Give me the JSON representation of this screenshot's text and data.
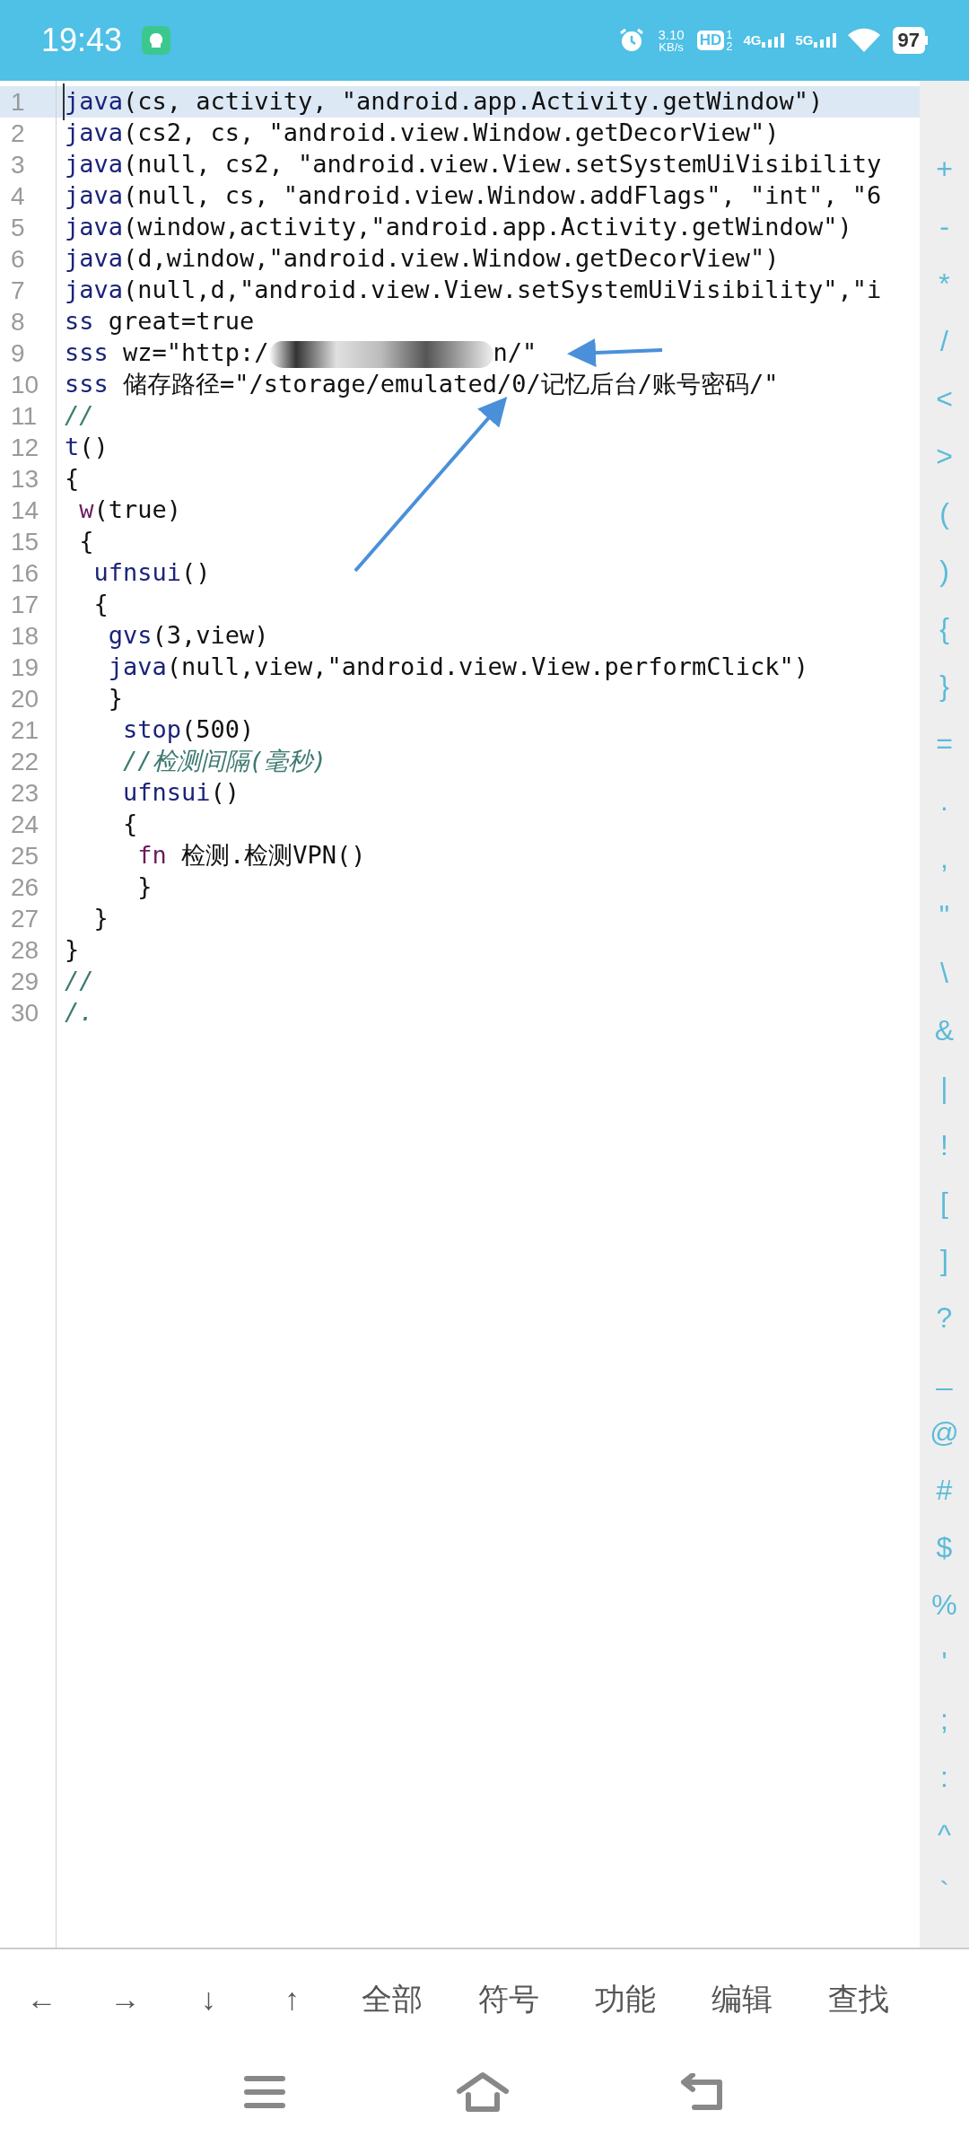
{
  "status_bar": {
    "time": "19:43",
    "network_speed": [
      "3.10",
      "KB/s"
    ],
    "hd": {
      "label": "HD",
      "sup": "1",
      "sub": "2"
    },
    "signals": [
      {
        "label": "4G"
      },
      {
        "label": "5G"
      }
    ],
    "battery": "97"
  },
  "editor": {
    "lines": [
      {
        "number": "1",
        "current": true,
        "tokens": [
          {
            "kind": "keyword",
            "text": "java"
          },
          {
            "kind": "plain",
            "text": "(cs, activity, \"android.app.Activity.getWindow\")"
          }
        ]
      },
      {
        "number": "2",
        "current": false,
        "tokens": [
          {
            "kind": "keyword",
            "text": "java"
          },
          {
            "kind": "plain",
            "text": "(cs2, cs, \"android.view.Window.getDecorView\")"
          }
        ]
      },
      {
        "number": "3",
        "current": false,
        "tokens": [
          {
            "kind": "keyword",
            "text": "java"
          },
          {
            "kind": "plain",
            "text": "(null, cs2, \"android.view.View.setSystemUiVisibility"
          }
        ]
      },
      {
        "number": "4",
        "current": false,
        "tokens": [
          {
            "kind": "keyword",
            "text": "java"
          },
          {
            "kind": "plain",
            "text": "(null, cs, \"android.view.Window.addFlags\", \"int\", \"6"
          }
        ]
      },
      {
        "number": "5",
        "current": false,
        "tokens": [
          {
            "kind": "keyword",
            "text": "java"
          },
          {
            "kind": "plain",
            "text": "(window,activity,\"android.app.Activity.getWindow\")"
          }
        ]
      },
      {
        "number": "6",
        "current": false,
        "tokens": [
          {
            "kind": "keyword",
            "text": "java"
          },
          {
            "kind": "plain",
            "text": "(d,window,\"android.view.Window.getDecorView\")"
          }
        ]
      },
      {
        "number": "7",
        "current": false,
        "tokens": [
          {
            "kind": "keyword",
            "text": "java"
          },
          {
            "kind": "plain",
            "text": "(null,d,\"android.view.View.setSystemUiVisibility\",\"i"
          }
        ]
      },
      {
        "number": "8",
        "current": false,
        "tokens": [
          {
            "kind": "keyword",
            "text": "ss"
          },
          {
            "kind": "plain",
            "text": " great=true"
          }
        ]
      },
      {
        "number": "9",
        "current": false,
        "tokens": [
          {
            "kind": "keyword",
            "text": "sss"
          },
          {
            "kind": "plain",
            "text": " wz=\"http:/"
          },
          {
            "kind": "redacted"
          },
          {
            "kind": "plain",
            "text": "n/\""
          }
        ]
      },
      {
        "number": "10",
        "current": false,
        "tokens": [
          {
            "kind": "keyword",
            "text": "sss"
          },
          {
            "kind": "plain",
            "text": " 储存路径=\"/storage/emulated/0/记忆后台/账号密码/\""
          }
        ]
      },
      {
        "number": "11",
        "current": false,
        "tokens": [
          {
            "kind": "comment",
            "text": "//"
          }
        ]
      },
      {
        "number": "12",
        "current": false,
        "tokens": [
          {
            "kind": "keyword",
            "text": "t"
          },
          {
            "kind": "plain",
            "text": "()"
          }
        ]
      },
      {
        "number": "13",
        "current": false,
        "tokens": [
          {
            "kind": "plain",
            "text": "{"
          }
        ]
      },
      {
        "number": "14",
        "current": false,
        "tokens": [
          {
            "kind": "function",
            "text": " w"
          },
          {
            "kind": "plain",
            "text": "(true)"
          }
        ]
      },
      {
        "number": "15",
        "current": false,
        "tokens": [
          {
            "kind": "plain",
            "text": " {"
          }
        ]
      },
      {
        "number": "16",
        "current": false,
        "tokens": [
          {
            "kind": "keyword",
            "text": "  ufnsui"
          },
          {
            "kind": "plain",
            "text": "()"
          }
        ]
      },
      {
        "number": "17",
        "current": false,
        "tokens": [
          {
            "kind": "plain",
            "text": "  {"
          }
        ]
      },
      {
        "number": "18",
        "current": false,
        "tokens": [
          {
            "kind": "keyword",
            "text": "   gvs"
          },
          {
            "kind": "plain",
            "text": "(3,view)"
          }
        ]
      },
      {
        "number": "19",
        "current": false,
        "tokens": [
          {
            "kind": "keyword",
            "text": "   java"
          },
          {
            "kind": "plain",
            "text": "(null,view,\"android.view.View.performClick\")"
          }
        ]
      },
      {
        "number": "20",
        "current": false,
        "tokens": [
          {
            "kind": "plain",
            "text": "   }"
          }
        ]
      },
      {
        "number": "21",
        "current": false,
        "tokens": [
          {
            "kind": "keyword",
            "text": "    stop"
          },
          {
            "kind": "plain",
            "text": "(500)"
          }
        ]
      },
      {
        "number": "22",
        "current": false,
        "tokens": [
          {
            "kind": "comment",
            "text": "    //检测间隔(毫秒)"
          }
        ]
      },
      {
        "number": "23",
        "current": false,
        "tokens": [
          {
            "kind": "keyword",
            "text": "    ufnsui"
          },
          {
            "kind": "plain",
            "text": "()"
          }
        ]
      },
      {
        "number": "24",
        "current": false,
        "tokens": [
          {
            "kind": "plain",
            "text": "    {"
          }
        ]
      },
      {
        "number": "25",
        "current": false,
        "tokens": [
          {
            "kind": "function",
            "text": "     fn"
          },
          {
            "kind": "plain",
            "text": " 检测.检测VPN()"
          }
        ]
      },
      {
        "number": "26",
        "current": false,
        "tokens": [
          {
            "kind": "plain",
            "text": "     }"
          }
        ]
      },
      {
        "number": "27",
        "current": false,
        "tokens": [
          {
            "kind": "plain",
            "text": "  }"
          }
        ]
      },
      {
        "number": "28",
        "current": false,
        "tokens": [
          {
            "kind": "plain",
            "text": "}"
          }
        ]
      },
      {
        "number": "29",
        "current": false,
        "tokens": [
          {
            "kind": "comment",
            "text": "//"
          }
        ]
      },
      {
        "number": "30",
        "current": false,
        "tokens": [
          {
            "kind": "comment",
            "text": "/."
          }
        ]
      }
    ]
  },
  "symbol_keys": [
    "+",
    "-",
    "*",
    "/",
    "<",
    ">",
    "(",
    ")",
    "{",
    "}",
    "=",
    ".",
    ",",
    "\"",
    "\\",
    "&",
    "|",
    "!",
    "[",
    "]",
    "?",
    "_",
    "@",
    "#",
    "$",
    "%",
    "'",
    ";",
    ":",
    "^",
    "`"
  ],
  "toolbar": [
    "←",
    "→",
    "↓",
    "↑",
    "全部",
    "符号",
    "功能",
    "编辑",
    "查找"
  ]
}
